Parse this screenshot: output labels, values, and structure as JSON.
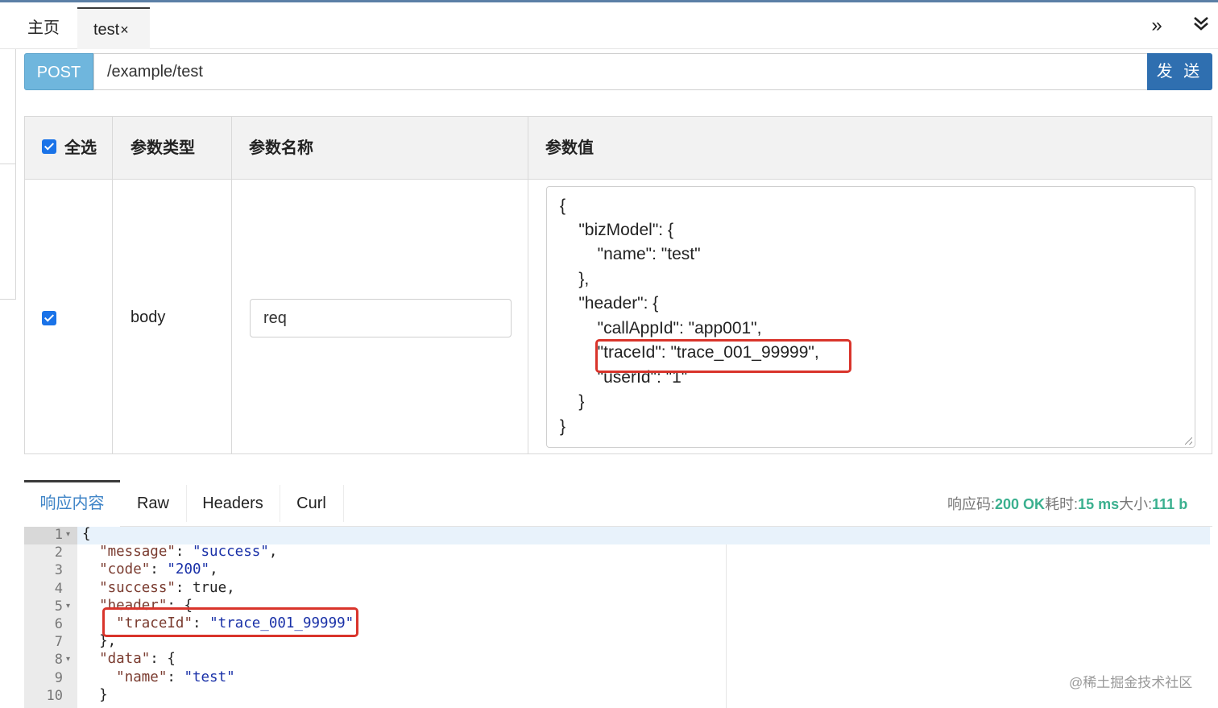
{
  "tabs": {
    "home": "主页",
    "test": "test",
    "close": "×"
  },
  "toolbar": {
    "more_icon": "»",
    "collapse_icon": "⌄"
  },
  "request": {
    "method": "POST",
    "url": "/example/test",
    "send": "发 送"
  },
  "params": {
    "headers": {
      "select_all": "全选",
      "type": "参数类型",
      "name": "参数名称",
      "value": "参数值"
    },
    "row": {
      "checked": true,
      "type": "body",
      "name": "req",
      "value_lines": [
        "{",
        "    \"bizModel\": {",
        "        \"name\": \"test\"",
        "    },",
        "    \"header\": {",
        "        \"callAppId\": \"app001\",",
        "        \"traceId\": \"trace_001_99999\",",
        "        \"userId\": \"1\"",
        "    }",
        "}"
      ]
    }
  },
  "response": {
    "tabs": [
      "响应内容",
      "Raw",
      "Headers",
      "Curl"
    ],
    "status": {
      "code_label": "响应码:",
      "code": "200 OK",
      "time_label": "耗时:",
      "time": "15 ms",
      "size_label": "大小:",
      "size": "111 b"
    },
    "lines": [
      {
        "n": "1",
        "text": "{"
      },
      {
        "n": "2",
        "key": "\"message\"",
        "sep": ": ",
        "val": "\"success\"",
        "tail": ",",
        "indent": "  "
      },
      {
        "n": "3",
        "key": "\"code\"",
        "sep": ": ",
        "val": "\"200\"",
        "tail": ",",
        "indent": "  "
      },
      {
        "n": "4",
        "key": "\"success\"",
        "sep": ": ",
        "plain": "true,",
        "indent": "  "
      },
      {
        "n": "5",
        "key": "\"header\"",
        "sep": ": ",
        "plain": "{",
        "indent": "  "
      },
      {
        "n": "6",
        "key": "\"traceId\"",
        "sep": ": ",
        "val": "\"trace_001_99999\"",
        "tail": "",
        "indent": "    "
      },
      {
        "n": "7",
        "text": "  },"
      },
      {
        "n": "8",
        "key": "\"data\"",
        "sep": ": ",
        "plain": "{",
        "indent": "  "
      },
      {
        "n": "9",
        "key": "\"name\"",
        "sep": ": ",
        "val": "\"test\"",
        "tail": "",
        "indent": "    "
      },
      {
        "n": "10",
        "text": "  }"
      }
    ]
  },
  "watermark": "@稀土掘金技术社区"
}
